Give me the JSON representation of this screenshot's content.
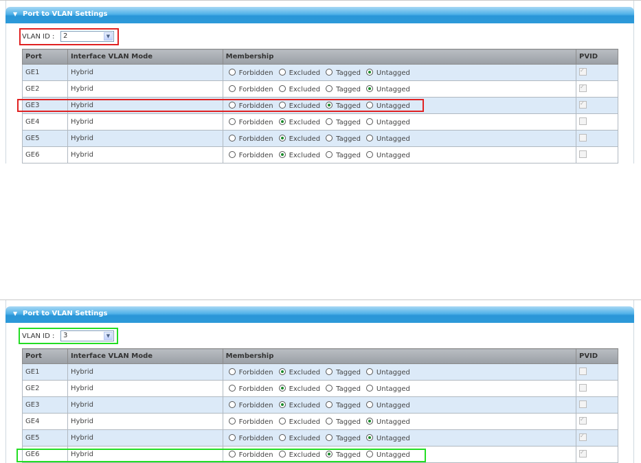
{
  "panels": [
    {
      "title": "Port to VLAN Settings",
      "vlan_label": "VLAN ID :",
      "vlan_value": "2",
      "columns": [
        "Port",
        "Interface VLAN Mode",
        "Membership",
        "PVID"
      ],
      "membership_options": [
        "Forbidden",
        "Excluded",
        "Tagged",
        "Untagged"
      ],
      "rows": [
        {
          "port": "GE1",
          "mode": "Hybrid",
          "membership": "Untagged",
          "pvid": true
        },
        {
          "port": "GE2",
          "mode": "Hybrid",
          "membership": "Untagged",
          "pvid": true
        },
        {
          "port": "GE3",
          "mode": "Hybrid",
          "membership": "Tagged",
          "pvid": true
        },
        {
          "port": "GE4",
          "mode": "Hybrid",
          "membership": "Excluded",
          "pvid": false
        },
        {
          "port": "GE5",
          "mode": "Hybrid",
          "membership": "Excluded",
          "pvid": false
        },
        {
          "port": "GE6",
          "mode": "Hybrid",
          "membership": "Excluded",
          "pvid": false
        }
      ],
      "highlight_color": "#e02020"
    },
    {
      "title": "Port to VLAN Settings",
      "vlan_label": "VLAN ID :",
      "vlan_value": "3",
      "columns": [
        "Port",
        "Interface VLAN Mode",
        "Membership",
        "PVID"
      ],
      "membership_options": [
        "Forbidden",
        "Excluded",
        "Tagged",
        "Untagged"
      ],
      "rows": [
        {
          "port": "GE1",
          "mode": "Hybrid",
          "membership": "Excluded",
          "pvid": false
        },
        {
          "port": "GE2",
          "mode": "Hybrid",
          "membership": "Excluded",
          "pvid": false
        },
        {
          "port": "GE3",
          "mode": "Hybrid",
          "membership": "Excluded",
          "pvid": false
        },
        {
          "port": "GE4",
          "mode": "Hybrid",
          "membership": "Untagged",
          "pvid": true
        },
        {
          "port": "GE5",
          "mode": "Hybrid",
          "membership": "Untagged",
          "pvid": true
        },
        {
          "port": "GE6",
          "mode": "Hybrid",
          "membership": "Tagged",
          "pvid": true
        }
      ],
      "highlight_color": "#22dd22"
    }
  ]
}
